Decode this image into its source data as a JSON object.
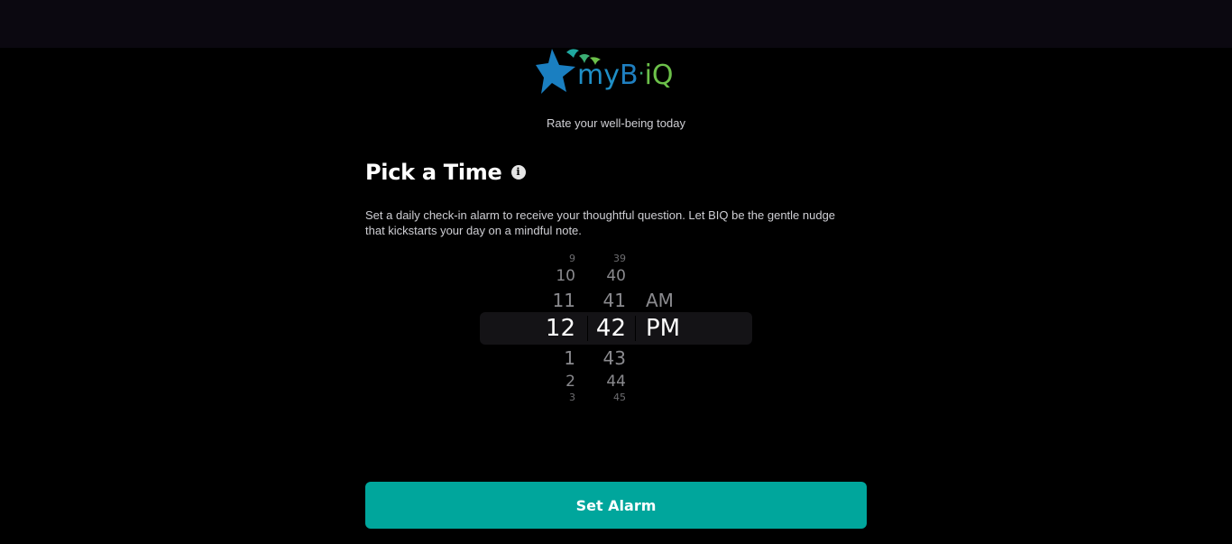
{
  "brand": {
    "logo_my": "my",
    "logo_b": "B",
    "logo_dot": "·",
    "logo_iq": "iQ",
    "colors": {
      "star_blue": "#1a7fc1",
      "bird_teal": "#1fa8a0",
      "bird_green": "#6cc04a"
    }
  },
  "header": {
    "subtitle": "Rate your well-being today"
  },
  "main": {
    "title": "Pick a Time",
    "info_icon": "info-icon",
    "description": "Set a daily check-in alarm to receive your thoughtful question. Let BIQ be the gentle nudge that kickstarts your day on a mindful note."
  },
  "picker": {
    "hours": [
      "9",
      "10",
      "11",
      "12",
      "1",
      "2",
      "3"
    ],
    "minutes": [
      "39",
      "40",
      "41",
      "42",
      "43",
      "44",
      "45"
    ],
    "periods": [
      "AM",
      "PM"
    ],
    "selected_hour": "12",
    "selected_minute": "42",
    "selected_period": "PM"
  },
  "actions": {
    "set_alarm_label": "Set Alarm",
    "accent_color": "#00a69c"
  }
}
